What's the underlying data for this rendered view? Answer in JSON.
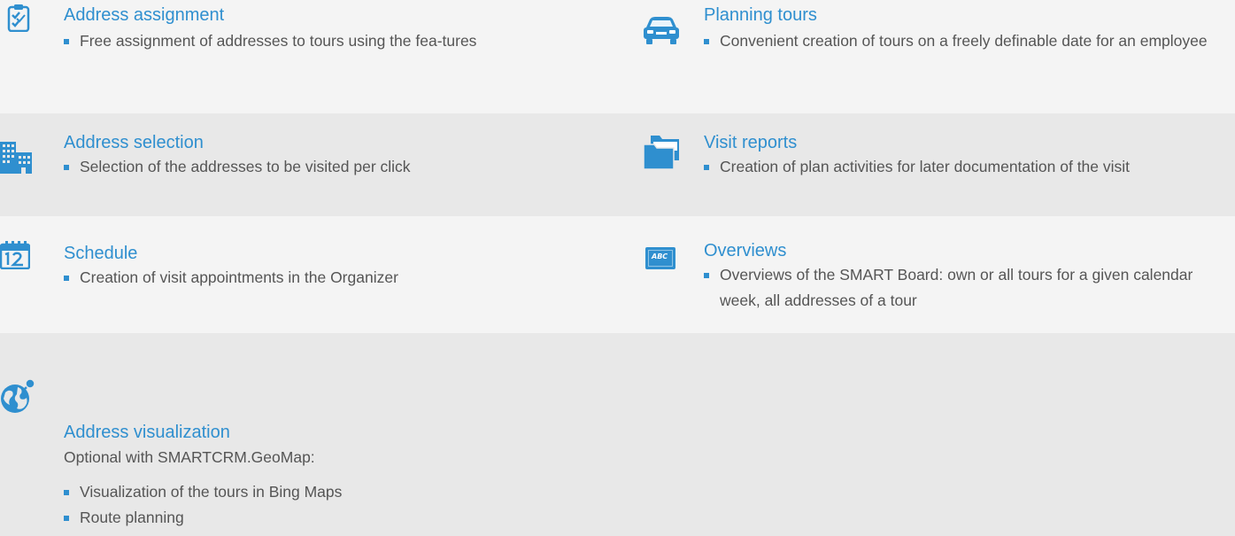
{
  "colors": {
    "accent": "#2f8fcf",
    "text": "#555555",
    "band_light": "#f4f4f4",
    "band_dark": "#e8e8e8"
  },
  "features": {
    "address_assignment": {
      "icon": "clipboard-check-icon",
      "title": "Address assignment",
      "bullets": [
        "Free assignment of addresses to tours using the fea-tures"
      ]
    },
    "planning_tours": {
      "icon": "car-icon",
      "title": "Planning tours",
      "bullets": [
        "Convenient creation of tours on a freely definable date for an employee"
      ]
    },
    "address_selection": {
      "icon": "buildings-icon",
      "title": "Address selection",
      "bullets": [
        "Selection of the addresses to be visited per click"
      ]
    },
    "visit_reports": {
      "icon": "folders-icon",
      "title": "Visit reports",
      "bullets": [
        "Creation of plan activities for later documentation of the visit"
      ]
    },
    "schedule": {
      "icon": "calendar-icon",
      "title": "Schedule",
      "bullets": [
        "Creation of visit appointments in the Organizer"
      ]
    },
    "overviews": {
      "icon": "board-abc-icon",
      "icon_text": "ABC",
      "title": "Overviews",
      "bullets": [
        "Overviews of the SMART Board: own or all tours for a given calendar week, all addresses of a tour"
      ]
    },
    "address_visualization": {
      "icon": "globe-pin-icon",
      "title": "Address visualization",
      "intro": "Optional with SMARTCRM.GeoMap:",
      "bullets": [
        "Visualization of the tours in Bing Maps",
        "Route planning"
      ]
    }
  }
}
